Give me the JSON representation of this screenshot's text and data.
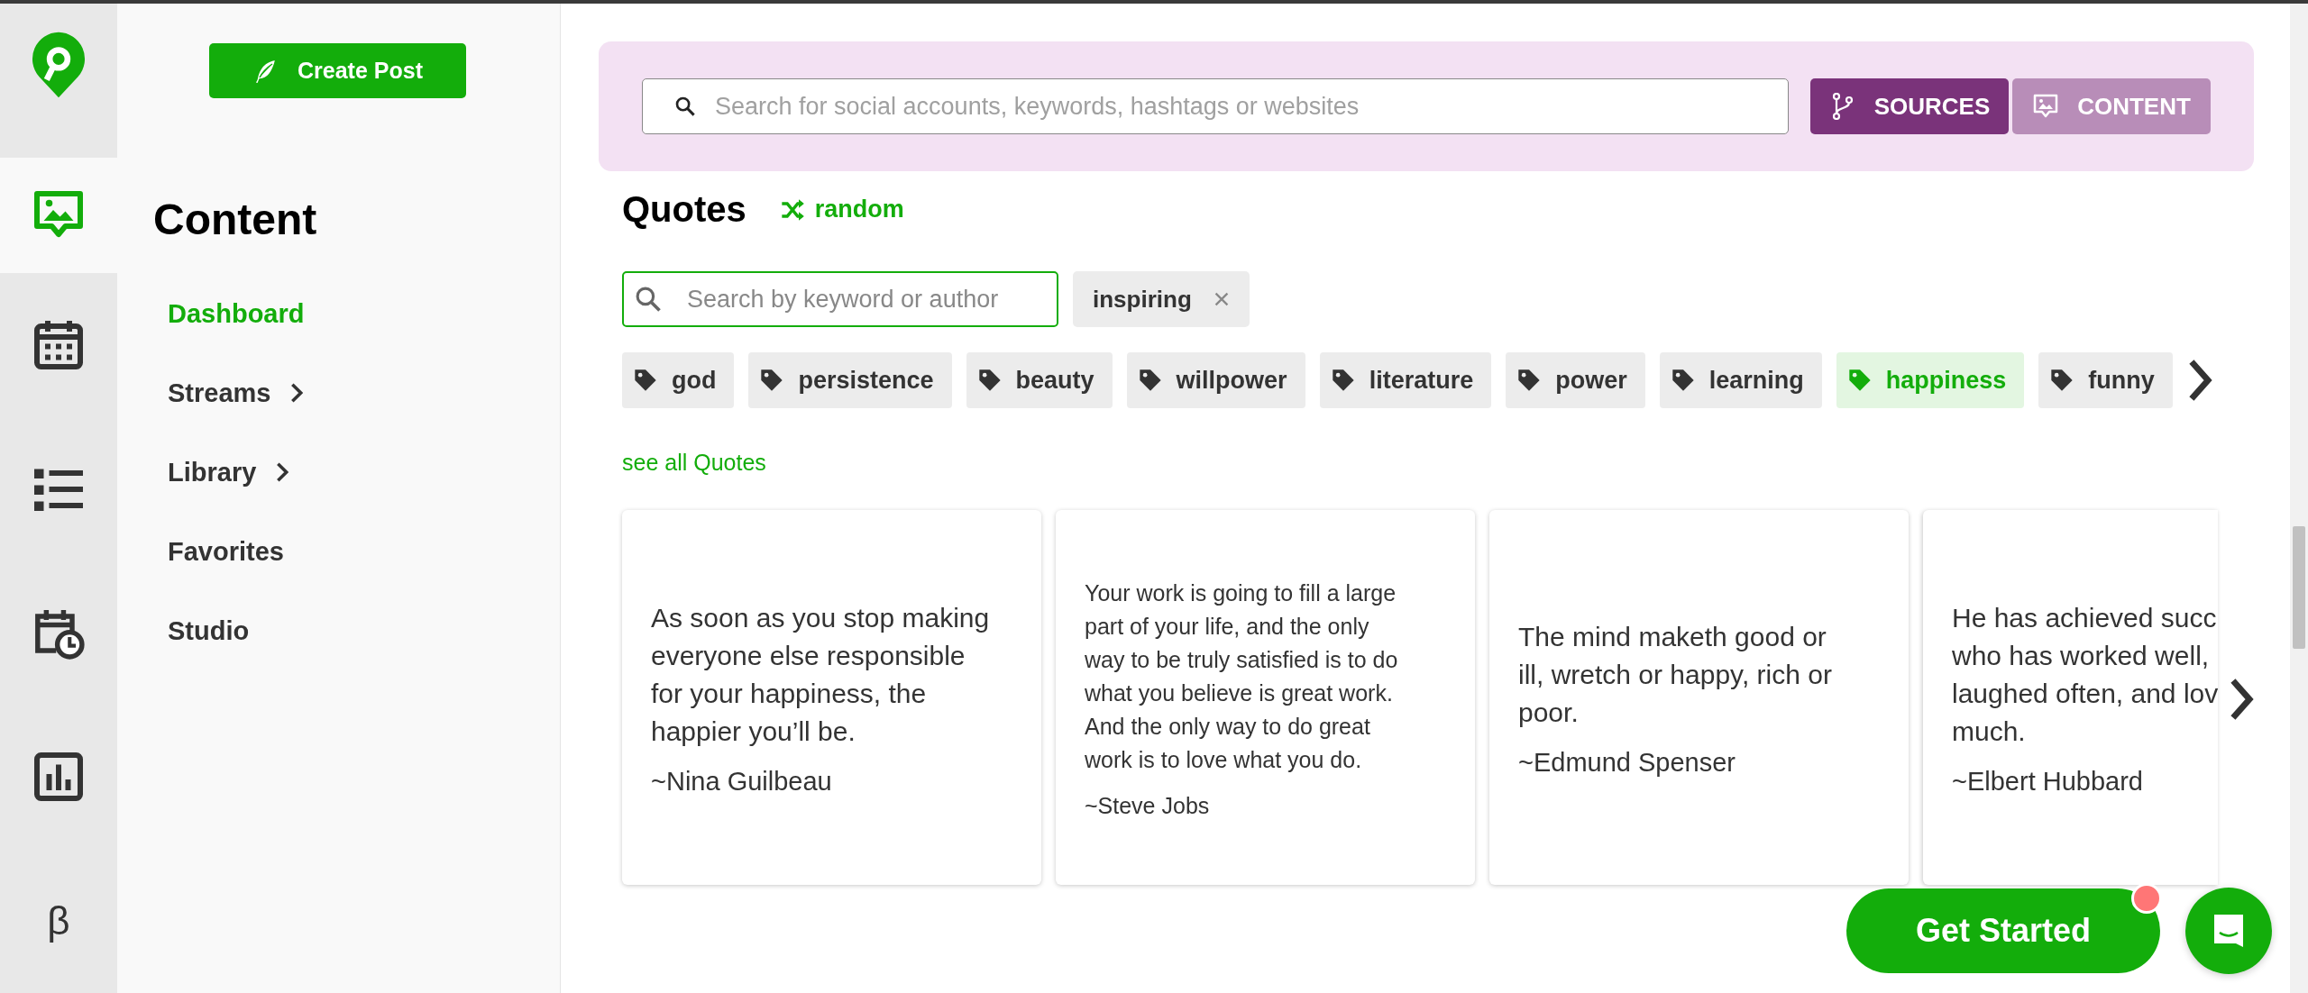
{
  "rail": {
    "items": [
      {
        "kind": "logo",
        "selected": false
      },
      {
        "kind": "content",
        "selected": true
      },
      {
        "kind": "calendar",
        "selected": false
      },
      {
        "kind": "list",
        "selected": false
      },
      {
        "kind": "schedule",
        "selected": false
      },
      {
        "kind": "analytics",
        "selected": false
      },
      {
        "kind": "beta",
        "label": "β",
        "selected": false
      }
    ]
  },
  "sidebar": {
    "create_post": "Create Post",
    "heading": "Content",
    "items": [
      {
        "label": "Dashboard",
        "selected": true,
        "has_submenu": false
      },
      {
        "label": "Streams",
        "selected": false,
        "has_submenu": true
      },
      {
        "label": "Library",
        "selected": false,
        "has_submenu": true
      },
      {
        "label": "Favorites",
        "selected": false,
        "has_submenu": false
      },
      {
        "label": "Studio",
        "selected": false,
        "has_submenu": false
      }
    ]
  },
  "search": {
    "placeholder": "Search for social accounts, keywords, hashtags or websites",
    "modes": [
      {
        "kind": "sources",
        "label": "SOURCES",
        "selected": true
      },
      {
        "kind": "content",
        "label": "CONTENT",
        "selected": false
      }
    ]
  },
  "quotes": {
    "title": "Quotes",
    "random": "random",
    "search_placeholder": "Search by keyword or author",
    "active_filters": [
      {
        "label": "inspiring"
      }
    ],
    "tags": [
      {
        "label": "god",
        "selected": false
      },
      {
        "label": "persistence",
        "selected": false
      },
      {
        "label": "beauty",
        "selected": false
      },
      {
        "label": "willpower",
        "selected": false
      },
      {
        "label": "literature",
        "selected": false
      },
      {
        "label": "power",
        "selected": false
      },
      {
        "label": "learning",
        "selected": false
      },
      {
        "label": "happiness",
        "selected": true
      },
      {
        "label": "funny",
        "selected": false
      }
    ],
    "see_all": "see all Quotes",
    "cards": [
      {
        "kind": "regular",
        "lines": [
          "As soon as you stop making",
          "everyone else responsible",
          "for your happiness, the",
          "happier you’ll be."
        ],
        "author": "~Nina Guilbeau"
      },
      {
        "kind": "long",
        "lines": [
          "Your work is going to fill a large",
          "part of your life, and the only",
          "way to be truly satisfied is to do",
          "what you believe is great work.",
          "And the only way to do great",
          "work is to love what you do."
        ],
        "author": "~Steve Jobs"
      },
      {
        "kind": "regular",
        "lines": [
          "The mind maketh good or",
          "ill, wretch or happy, rich or",
          "poor."
        ],
        "author": "~Edmund Spenser"
      },
      {
        "kind": "regular",
        "lines": [
          "He has achieved succ",
          "who has worked well,",
          "laughed often, and lov",
          "much."
        ],
        "author": "~Elbert Hubbard"
      }
    ]
  },
  "get_started": {
    "label": "Get Started",
    "notification": true
  }
}
